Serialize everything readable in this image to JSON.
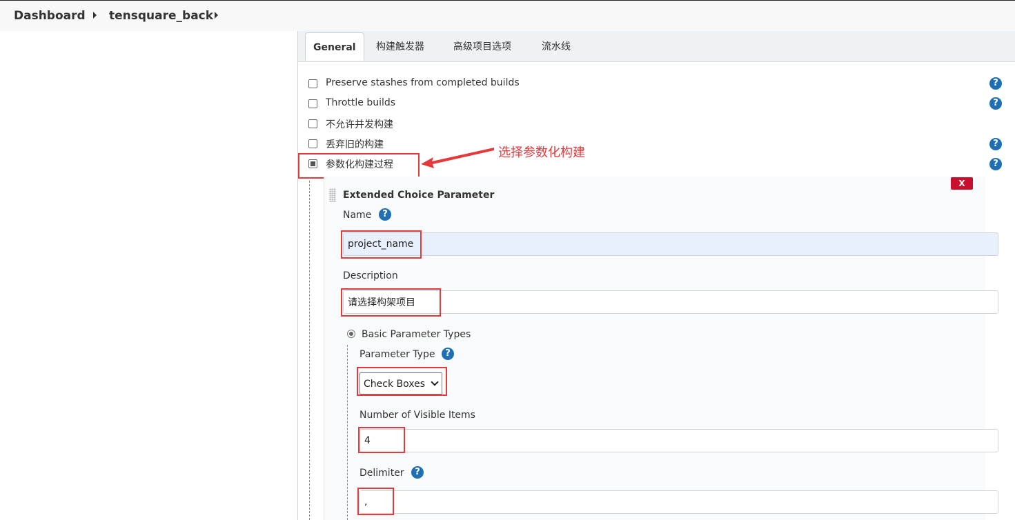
{
  "breadcrumb": {
    "items": [
      "Dashboard",
      "tensquare_back"
    ]
  },
  "tabs": [
    {
      "label": "General",
      "active": true
    },
    {
      "label": "构建触发器"
    },
    {
      "label": "高级项目选项"
    },
    {
      "label": "流水线"
    }
  ],
  "options": [
    {
      "label": "Preserve stashes from completed builds",
      "checked": false,
      "help": true
    },
    {
      "label": "Throttle builds",
      "checked": false,
      "help": true
    },
    {
      "label": "不允许并发构建",
      "checked": false,
      "help": false
    },
    {
      "label": "丢弃旧的构建",
      "checked": false,
      "help": true
    },
    {
      "label": "参数化构建过程",
      "checked": true,
      "help": true
    }
  ],
  "annotation": {
    "text": "选择参数化构建",
    "color": "#e5393b"
  },
  "parameter": {
    "title": "Extended Choice Parameter",
    "delete_label": "X",
    "name_label": "Name",
    "name_value": "project_name",
    "description_label": "Description",
    "description_value": "请选择构架项目",
    "basic_types_label": "Basic Parameter Types",
    "type_label": "Parameter Type",
    "type_value": "Check Boxes",
    "visible_items_label": "Number of Visible Items",
    "visible_items_value": "4",
    "delimiter_label": "Delimiter",
    "delimiter_value": ","
  },
  "icons": {
    "help": "help-icon",
    "arrow": "annotation-arrow-icon",
    "drag": "drag-handle-icon"
  },
  "colors": {
    "accent": "#1f6fb2",
    "highlight": "#e5393b",
    "delete": "#c8102e"
  }
}
